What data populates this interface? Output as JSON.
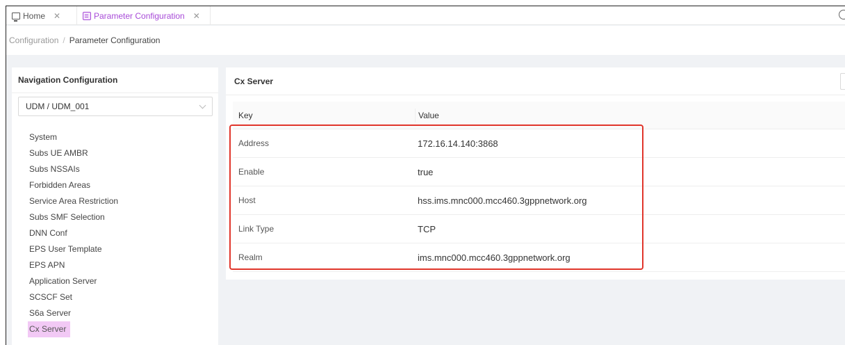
{
  "tabs": [
    {
      "label": "Home",
      "icon": "monitor-icon",
      "active": false
    },
    {
      "label": "Parameter Configuration",
      "icon": "config-icon",
      "active": true
    }
  ],
  "breadcrumb": {
    "root": "Configuration",
    "separator": "/",
    "current": "Parameter Configuration"
  },
  "nav": {
    "title": "Navigation Configuration",
    "select_value": "UDM / UDM_001",
    "items": [
      {
        "label": "System"
      },
      {
        "label": "Subs UE AMBR"
      },
      {
        "label": "Subs NSSAIs"
      },
      {
        "label": "Forbidden Areas"
      },
      {
        "label": "Service Area Restriction"
      },
      {
        "label": "Subs SMF Selection"
      },
      {
        "label": "DNN Conf"
      },
      {
        "label": "EPS User Template"
      },
      {
        "label": "EPS APN"
      },
      {
        "label": "Application Server"
      },
      {
        "label": "SCSCF Set"
      },
      {
        "label": "S6a Server"
      },
      {
        "label": "Cx Server"
      }
    ],
    "active_item": "Cx Server"
  },
  "panel": {
    "title": "Cx Server",
    "columns": {
      "key": "Key",
      "value": "Value"
    },
    "rows": [
      {
        "key": "Address",
        "value": "172.16.14.140:3868"
      },
      {
        "key": "Enable",
        "value": "true"
      },
      {
        "key": "Host",
        "value": "hss.ims.mnc000.mcc460.3gppnetwork.org"
      },
      {
        "key": "Link Type",
        "value": "TCP"
      },
      {
        "key": "Realm",
        "value": "ims.mnc000.mcc460.3gppnetwork.org"
      }
    ]
  },
  "colors": {
    "accent": "#a84bd8",
    "active_bg": "#f2c9f5",
    "highlight": "#e0352b"
  }
}
